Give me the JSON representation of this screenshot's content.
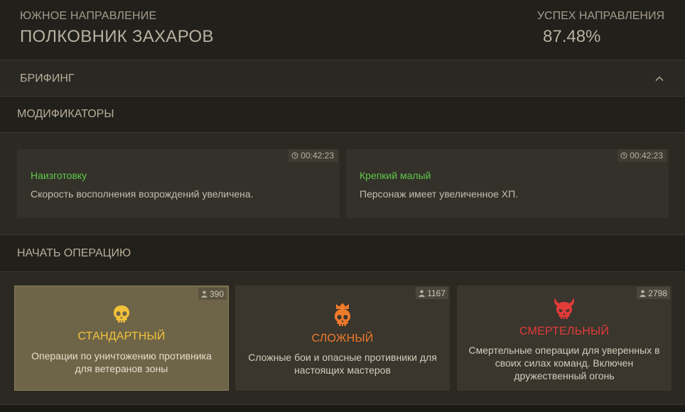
{
  "header": {
    "direction_label": "ЮЖНОЕ НАПРАВЛЕНИЕ",
    "commander": "ПОЛКОВНИК ЗАХАРОВ",
    "success_label": "УСПЕХ НАПРАВЛЕНИЯ",
    "success_value": "87.48%"
  },
  "briefing": {
    "title": "БРИФИНГ",
    "icon": "chevron-up-icon"
  },
  "modifiers": {
    "title": "МОДИФИКАТОРЫ",
    "items": [
      {
        "timer": "00:42:23",
        "name": "Наизготовку",
        "description": "Скорость восполнения возрождений увеличена."
      },
      {
        "timer": "00:42:23",
        "name": "Крепкий малый",
        "description": "Персонаж имеет увеличенное ХП."
      }
    ]
  },
  "operations": {
    "title": "НАЧАТЬ ОПЕРАЦИЮ",
    "items": [
      {
        "players": "390",
        "name": "СТАНДАРТНЫЙ",
        "description": "Операции по уничтожению противника для ветеранов зоны",
        "icon": "skull-icon",
        "color": "#f2c23a",
        "selected": true
      },
      {
        "players": "1167",
        "name": "СЛОЖНЫЙ",
        "description": "Сложные бои и опасные противники для настоящих мастеров",
        "icon": "crowned-skull-icon",
        "color": "#ef7a2b",
        "selected": false
      },
      {
        "players": "2798",
        "name": "СМЕРТЕЛЬНЫЙ",
        "description": "Смертельные операции для уверенных в своих силах команд. Включен дружественный огонь",
        "icon": "demon-skull-icon",
        "color": "#e33a3a",
        "selected": false
      }
    ]
  },
  "colors": {
    "accent_green": "#5ec94b",
    "background": "#1f1d18"
  }
}
